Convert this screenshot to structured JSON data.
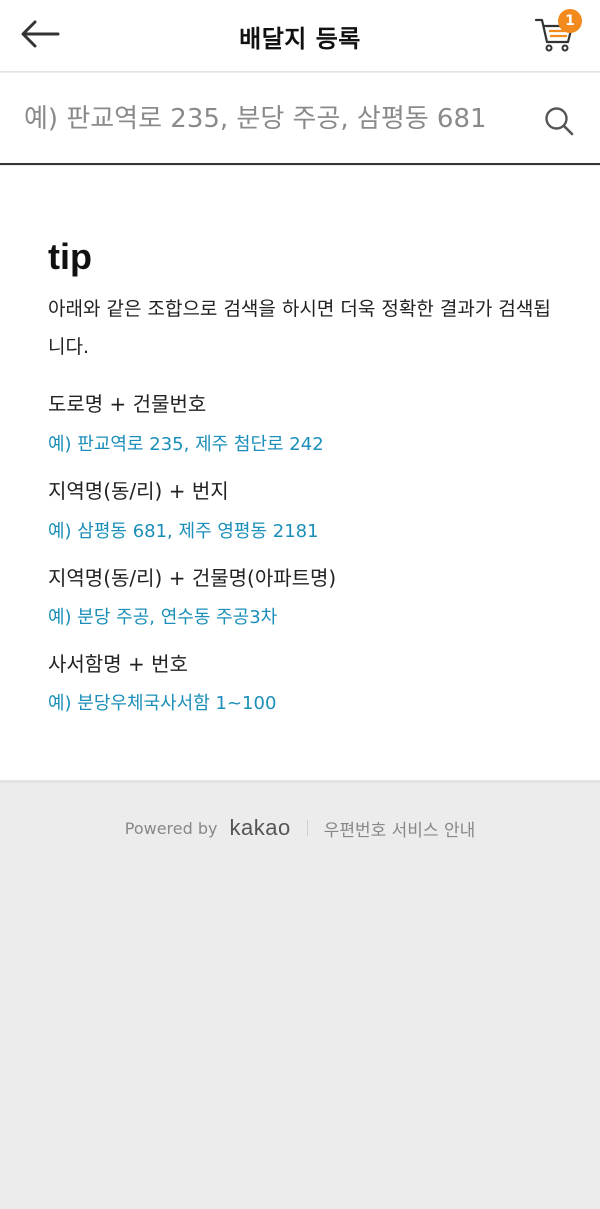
{
  "header": {
    "title": "배달지 등록",
    "cart_count": "1"
  },
  "search": {
    "placeholder": "예) 판교역로 235, 분당 주공, 삼평동 681"
  },
  "tips": {
    "heading": "tip",
    "description": "아래와 같은 조합으로 검색을 하시면 더욱 정확한 결과가 검색됩니다.",
    "items": [
      {
        "label": "도로명 + 건물번호",
        "example": "예) 판교역로 235,  제주 첨단로 242"
      },
      {
        "label": "지역명(동/리) + 번지",
        "example": "예) 삼평동 681,  제주 영평동 2181"
      },
      {
        "label": "지역명(동/리) + 건물명(아파트명)",
        "example": "예) 분당 주공,  연수동 주공3차"
      },
      {
        "label": "사서함명 + 번호",
        "example": "예) 분당우체국사서함 1~100"
      }
    ]
  },
  "footer": {
    "powered_by": "Powered by",
    "brand": "kakao",
    "service_link": "우편번호 서비스 안내"
  },
  "colors": {
    "accent_badge": "#f28a1d",
    "example_text": "#1b8fb9"
  },
  "icons": [
    "back-arrow-icon",
    "cart-icon",
    "search-icon"
  ]
}
